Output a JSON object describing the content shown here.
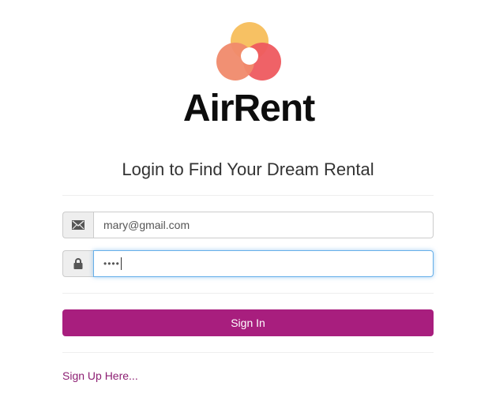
{
  "brand": {
    "name": "AirRent",
    "logo_colors": [
      "#f7c163",
      "#ee5a5f",
      "#f08a6c"
    ]
  },
  "login": {
    "heading": "Login to Find Your Dream Rental",
    "email_icon": "envelope-icon",
    "email_value": "mary@gmail.com",
    "password_icon": "lock-icon",
    "password_masked": "••••",
    "sign_in_label": "Sign In",
    "sign_up_label": "Sign Up Here..."
  },
  "colors": {
    "primary_button": "#a81e7e",
    "link": "#8d1f73",
    "focus_border": "#66afe9"
  }
}
